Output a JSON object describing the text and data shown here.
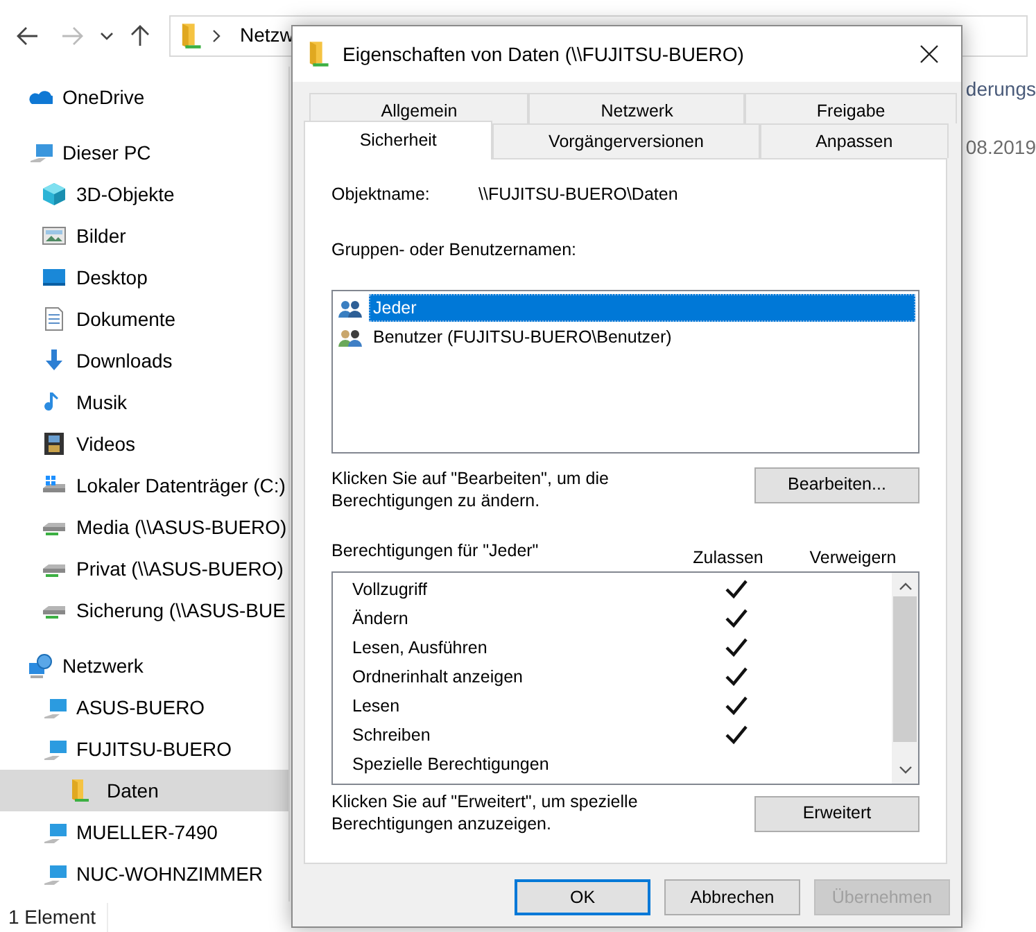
{
  "explorer": {
    "address_bar": {
      "path": "Netzw"
    },
    "sidebar": [
      {
        "label": "OneDrive",
        "kind": "cloud",
        "selected": false
      },
      {
        "label": "Dieser PC",
        "kind": "pc",
        "selected": false,
        "children": [
          {
            "label": "3D-Objekte",
            "kind": "objects3d",
            "selected": false
          },
          {
            "label": "Bilder",
            "kind": "pictures",
            "selected": false
          },
          {
            "label": "Desktop",
            "kind": "desktop",
            "selected": false
          },
          {
            "label": "Dokumente",
            "kind": "documents",
            "selected": false
          },
          {
            "label": "Downloads",
            "kind": "downloads",
            "selected": false
          },
          {
            "label": "Musik",
            "kind": "music",
            "selected": false
          },
          {
            "label": "Videos",
            "kind": "videos",
            "selected": false
          },
          {
            "label": "Lokaler Datenträger (C:)",
            "kind": "local-drive",
            "selected": false
          },
          {
            "label": "Media (\\\\ASUS-BUERO)",
            "kind": "network-drive",
            "selected": false
          },
          {
            "label": "Privat (\\\\ASUS-BUERO)",
            "kind": "network-drive",
            "selected": false
          },
          {
            "label": "Sicherung (\\\\ASUS-BUE",
            "kind": "network-drive",
            "selected": false
          }
        ]
      },
      {
        "label": "Netzwerk",
        "kind": "network",
        "selected": false,
        "children": [
          {
            "label": "ASUS-BUERO",
            "kind": "computer",
            "selected": false
          },
          {
            "label": "FUJITSU-BUERO",
            "kind": "computer",
            "selected": false,
            "children": [
              {
                "label": "Daten",
                "kind": "share",
                "selected": true
              }
            ]
          },
          {
            "label": "MUELLER-7490",
            "kind": "computer",
            "selected": false
          },
          {
            "label": "NUC-WOHNZIMMER",
            "kind": "computer",
            "selected": false
          }
        ]
      }
    ],
    "content": {
      "column_header": "derungs",
      "cell": "08.2019"
    },
    "status_bar": "1 Element"
  },
  "dialog": {
    "title": "Eigenschaften von Daten (\\\\FUJITSU-BUERO)",
    "tab_rows": [
      [
        {
          "label": "Allgemein",
          "selected": false
        },
        {
          "label": "Netzwerk",
          "selected": false
        },
        {
          "label": "Freigabe",
          "selected": false
        }
      ],
      [
        {
          "label": "Sicherheit",
          "selected": true
        },
        {
          "label": "Vorgängerversionen",
          "selected": false
        },
        {
          "label": "Anpassen",
          "selected": false
        }
      ]
    ],
    "object_label": "Objektname:",
    "object_value": "\\\\FUJITSU-BUERO\\Daten",
    "groups_label": "Gruppen- oder Benutzernamen:",
    "groups": [
      {
        "name": "Jeder",
        "kind": "group",
        "selected": true
      },
      {
        "name": "Benutzer (FUJITSU-BUERO\\Benutzer)",
        "kind": "users",
        "selected": false
      }
    ],
    "edit_hint": "Klicken Sie auf \"Bearbeiten\", um die Berechtigungen zu ändern.",
    "edit_button": "Bearbeiten...",
    "permissions_label": "Berechtigungen für \"Jeder\"",
    "allow_header": "Zulassen",
    "deny_header": "Verweigern",
    "permissions": [
      {
        "name": "Vollzugriff",
        "allow": true
      },
      {
        "name": "Ändern",
        "allow": true
      },
      {
        "name": "Lesen, Ausführen",
        "allow": true
      },
      {
        "name": "Ordnerinhalt anzeigen",
        "allow": true
      },
      {
        "name": "Lesen",
        "allow": true
      },
      {
        "name": "Schreiben",
        "allow": true
      },
      {
        "name": "Spezielle Berechtigungen",
        "allow": false
      }
    ],
    "advanced_hint": "Klicken Sie auf \"Erweitert\", um spezielle Berechtigungen anzuzeigen.",
    "advanced_button": "Erweitert",
    "buttons": [
      {
        "label": "OK",
        "default": true,
        "disabled": false
      },
      {
        "label": "Abbrechen",
        "default": false,
        "disabled": false
      },
      {
        "label": "Übernehmen",
        "default": false,
        "disabled": true
      }
    ]
  }
}
